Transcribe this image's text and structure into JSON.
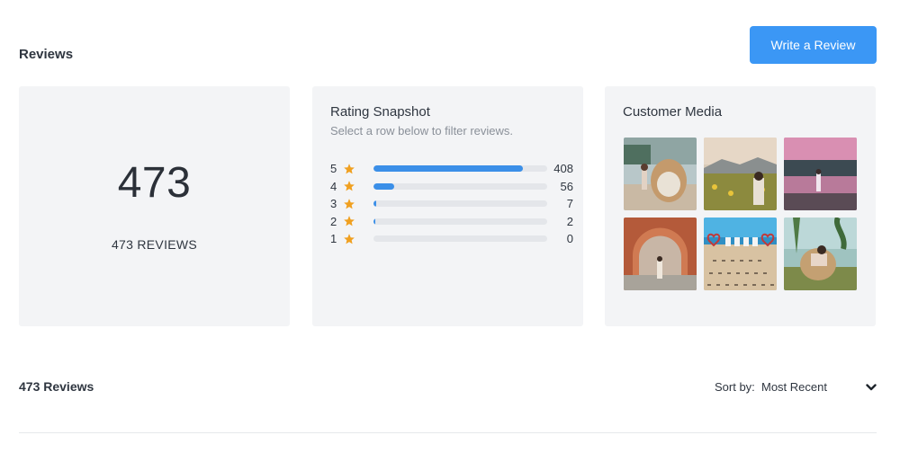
{
  "header": {
    "title": "Reviews",
    "write_review_label": "Write a Review"
  },
  "summary": {
    "total": "473",
    "reviews_label": "473 REVIEWS"
  },
  "snapshot": {
    "title": "Rating Snapshot",
    "subtitle": "Select a row below to filter reviews.",
    "total": 473,
    "rows": [
      {
        "stars": "5",
        "count": "408",
        "value": 408
      },
      {
        "stars": "4",
        "count": "56",
        "value": 56
      },
      {
        "stars": "3",
        "count": "7",
        "value": 7
      },
      {
        "stars": "2",
        "count": "2",
        "value": 2
      },
      {
        "stars": "1",
        "count": "0",
        "value": 0
      }
    ],
    "star_icon": "star-icon",
    "star_color": "#f0a020",
    "bar_color": "#3b8fe8"
  },
  "media": {
    "title": "Customer Media",
    "thumbnails": [
      {
        "description": "photo"
      },
      {
        "description": "photo"
      },
      {
        "description": "photo"
      },
      {
        "description": "photo"
      },
      {
        "description": "photo"
      },
      {
        "description": "photo"
      }
    ]
  },
  "list": {
    "count_label": "473 Reviews",
    "sort_label": "Sort by:",
    "sort_value": "Most Recent",
    "sort_icon": "chevron-down-icon"
  },
  "colors": {
    "accent": "#3b97f5",
    "card_bg": "#f3f4f6"
  }
}
